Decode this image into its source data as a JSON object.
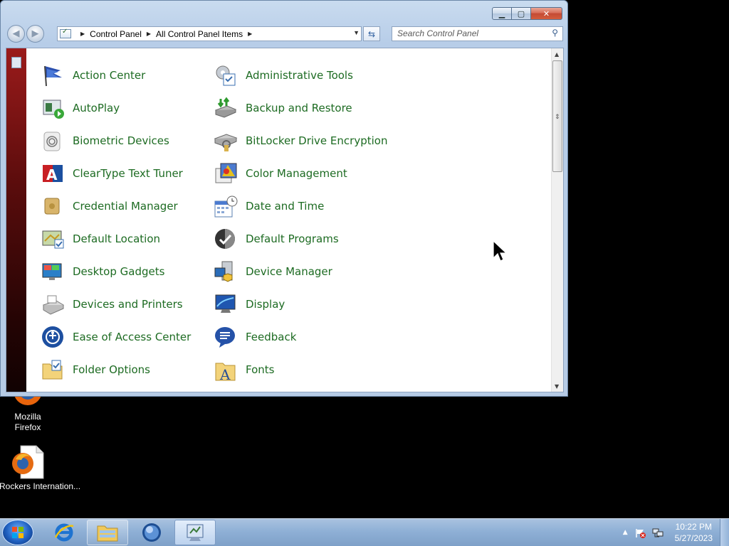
{
  "window": {
    "caption_buttons": {
      "minimize": "minimize-icon",
      "maximize": "maximize-icon",
      "close": "close-icon"
    },
    "address": {
      "breadcrumbs": [
        "Control Panel",
        "All Control Panel Items"
      ]
    },
    "search": {
      "placeholder": "Search Control Panel"
    }
  },
  "control_panel": {
    "left_column": [
      {
        "label": "Action Center",
        "icon": "flag-icon"
      },
      {
        "label": "AutoPlay",
        "icon": "autoplay-icon"
      },
      {
        "label": "Biometric Devices",
        "icon": "fingerprint-icon"
      },
      {
        "label": "ClearType Text Tuner",
        "icon": "cleartype-icon"
      },
      {
        "label": "Credential Manager",
        "icon": "credential-vault-icon"
      },
      {
        "label": "Default Location",
        "icon": "location-icon"
      },
      {
        "label": "Desktop Gadgets",
        "icon": "gadgets-icon"
      },
      {
        "label": "Devices and Printers",
        "icon": "printer-icon"
      },
      {
        "label": "Ease of Access Center",
        "icon": "ease-of-access-icon"
      },
      {
        "label": "Folder Options",
        "icon": "folder-options-icon"
      }
    ],
    "right_column": [
      {
        "label": "Administrative Tools",
        "icon": "admin-tools-icon"
      },
      {
        "label": "Backup and Restore",
        "icon": "backup-icon"
      },
      {
        "label": "BitLocker Drive Encryption",
        "icon": "bitlocker-icon"
      },
      {
        "label": "Color Management",
        "icon": "color-management-icon"
      },
      {
        "label": "Date and Time",
        "icon": "calendar-clock-icon"
      },
      {
        "label": "Default Programs",
        "icon": "default-programs-icon"
      },
      {
        "label": "Device Manager",
        "icon": "device-manager-icon"
      },
      {
        "label": "Display",
        "icon": "display-icon"
      },
      {
        "label": "Feedback",
        "icon": "feedback-icon"
      },
      {
        "label": "Fonts",
        "icon": "fonts-icon"
      }
    ]
  },
  "desktop": {
    "icons": [
      {
        "label": "Mozilla Firefox",
        "icon": "firefox-icon"
      },
      {
        "label": "Rockers Internation...",
        "icon": "firefox-document-icon"
      }
    ]
  },
  "taskbar": {
    "clock_time": "10:22 PM",
    "clock_date": "5/27/2023",
    "pinned": [
      "internet-explorer-icon",
      "windows-explorer-icon",
      "media-player-icon",
      "control-panel-icon"
    ]
  },
  "colors": {
    "link_green": "#1d6b22",
    "window_frame": "#b7cde8",
    "taskbar": "#8fb0d6",
    "close_red": "#c44a34"
  }
}
